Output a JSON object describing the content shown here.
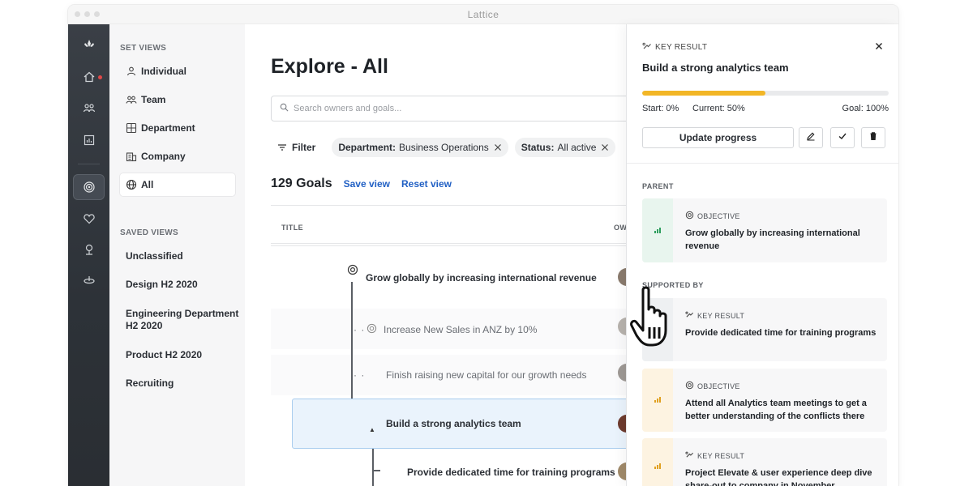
{
  "window": {
    "title": "Lattice"
  },
  "rail": {
    "icons": [
      "lattice-logo-icon",
      "home-icon",
      "people-icon",
      "chart-icon",
      "goals-icon",
      "heart-icon",
      "growth-icon",
      "compensation-icon"
    ]
  },
  "sidebar": {
    "set_views_heading": "SET VIEWS",
    "set_views": [
      {
        "label": "Individual",
        "icon": "person-icon"
      },
      {
        "label": "Team",
        "icon": "team-icon"
      },
      {
        "label": "Department",
        "icon": "department-icon"
      },
      {
        "label": "Company",
        "icon": "company-icon"
      },
      {
        "label": "All",
        "icon": "globe-icon",
        "active": true
      }
    ],
    "saved_views_heading": "SAVED VIEWS",
    "saved_views": [
      {
        "label": "Unclassified"
      },
      {
        "label": "Design H2 2020"
      },
      {
        "label": "Engineering Department H2 2020"
      },
      {
        "label": "Product H2 2020"
      },
      {
        "label": "Recruiting"
      }
    ]
  },
  "main": {
    "title": "Explore - All",
    "search": {
      "placeholder": "Search owners and goals..."
    },
    "filter_label": "Filter",
    "chips": [
      {
        "key": "Department:",
        "value": "Business Operations"
      },
      {
        "key": "Status:",
        "value": "All active"
      }
    ],
    "goals_count": "129 Goals",
    "save_view": "Save view",
    "reset_view": "Reset view",
    "columns": {
      "title": "TITLE",
      "owner": "OW"
    },
    "rows": [
      {
        "text": "Grow globally by increasing international revenue",
        "type": "objective"
      },
      {
        "text": "Increase New Sales in ANZ by 10%",
        "type": "objective"
      },
      {
        "text": "Finish raising new capital for our growth needs",
        "type": "key-result"
      },
      {
        "text": "Build a strong analytics team",
        "type": "key-result",
        "selected": true
      },
      {
        "text": "Provide dedicated time for training programs",
        "type": "key-result"
      }
    ]
  },
  "panel": {
    "type_label": "KEY RESULT",
    "title": "Build a strong analytics team",
    "progress": {
      "start": "Start: 0%",
      "current": "Current: 50%",
      "goal": "Goal: 100%",
      "fraction": 0.5
    },
    "update_button": "Update progress",
    "parent_heading": "PARENT",
    "parent": {
      "type": "OBJECTIVE",
      "title": "Grow globally by increasing international revenue",
      "accent": "#e8f5ee",
      "bar_color": "#2e9e5e"
    },
    "supported_heading": "SUPPORTED BY",
    "supported": [
      {
        "type": "KEY RESULT",
        "title": "Provide dedicated time for training programs",
        "accent": "#eef0f2",
        "bar_color": "#9aa0a6"
      },
      {
        "type": "OBJECTIVE",
        "title": "Attend all Analytics team meetings to get a better understanding of the conflicts there",
        "accent": "#fdf3e1",
        "bar_color": "#e0a020"
      },
      {
        "type": "KEY RESULT",
        "title": "Project Elevate & user experience deep dive share-out to company in November",
        "accent": "#fdf3e1",
        "bar_color": "#e0a020"
      }
    ]
  },
  "colors": {
    "rail_bg": "#2d3238",
    "accent_blue": "#2160c4",
    "progress": "#f2b626"
  }
}
